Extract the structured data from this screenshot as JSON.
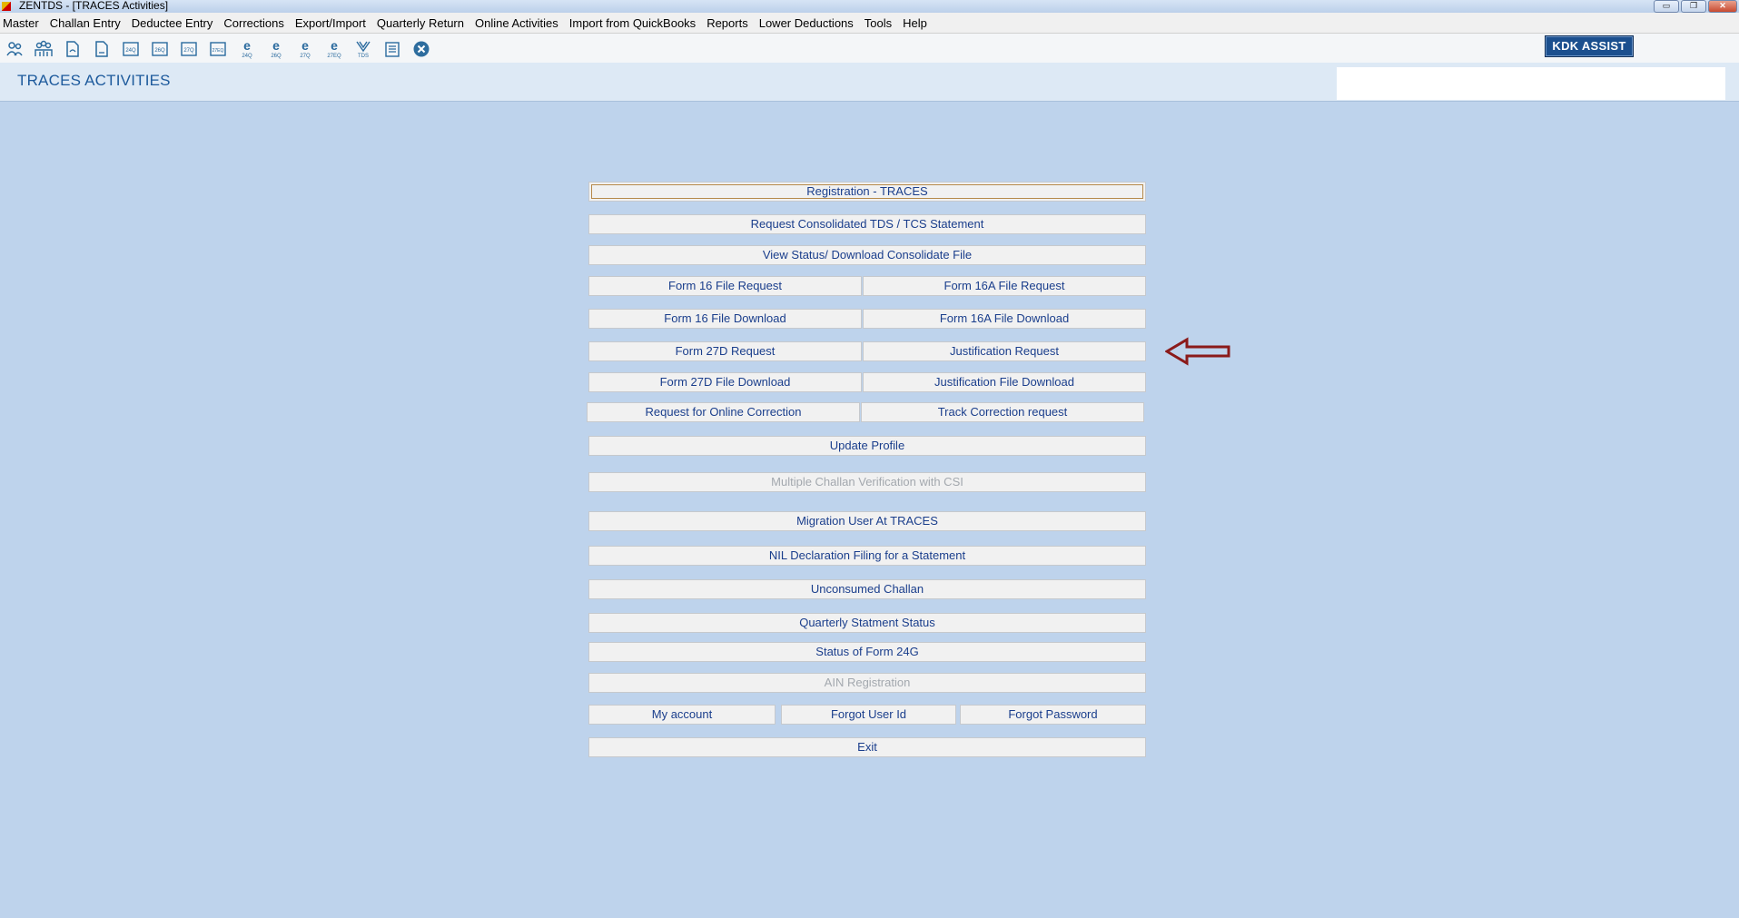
{
  "window": {
    "title": "ZENTDS - [TRACES Activities]",
    "controls": [
      "▭",
      "❐",
      "✕"
    ]
  },
  "menu": [
    "Master",
    "Challan Entry",
    "Deductee Entry",
    "Corrections",
    "Export/Import",
    "Quarterly Return",
    "Online Activities",
    "Import from QuickBooks",
    "Reports",
    "Lower Deductions",
    "Tools",
    "Help"
  ],
  "toolbar": {
    "icons": [
      "deductor-icon",
      "deductees-icon",
      "file-icon",
      "file-icon-2",
      "form-24q-icon",
      "form-26q-icon",
      "form-27q-icon",
      "form-27eq-icon",
      "e-24q-icon",
      "e-26q-icon",
      "e-27q-icon",
      "e-27eq-icon",
      "tds-icon",
      "document-icon",
      "close-icon"
    ],
    "kdk_assist": "KDK ASSIST"
  },
  "header": {
    "title": "TRACES ACTIVITIES"
  },
  "buttons": {
    "registration": "Registration - TRACES",
    "request_consolidated": "Request Consolidated TDS / TCS Statement",
    "view_status": "View Status/ Download Consolidate File",
    "form16_request": "Form 16 File Request",
    "form16a_request": "Form 16A File Request",
    "form16_download": "Form 16 File Download",
    "form16a_download": "Form 16A File Download",
    "form27d_request": "Form 27D Request",
    "justification_request": "Justification Request",
    "form27d_download": "Form 27D File Download",
    "justification_download": "Justification File Download",
    "online_correction": "Request for Online Correction",
    "track_correction": "Track Correction request",
    "update_profile": "Update Profile",
    "multiple_challan": "Multiple Challan Verification with CSI",
    "migration_user": "Migration User At TRACES",
    "nil_declaration": "NIL Declaration Filing for a Statement",
    "unconsumed_challan": "Unconsumed Challan",
    "quarterly_status": "Quarterly Statment Status",
    "form24g_status": "Status of Form 24G",
    "ain_registration": "AIN Registration",
    "my_account": "My account",
    "forgot_user_id": "Forgot User Id",
    "forgot_password": "Forgot Password",
    "exit": "Exit"
  },
  "colors": {
    "background": "#bed3ec",
    "button_text": "#1a3e8c",
    "header_text": "#1d5a9c",
    "arrow": "#8b1a1a"
  }
}
